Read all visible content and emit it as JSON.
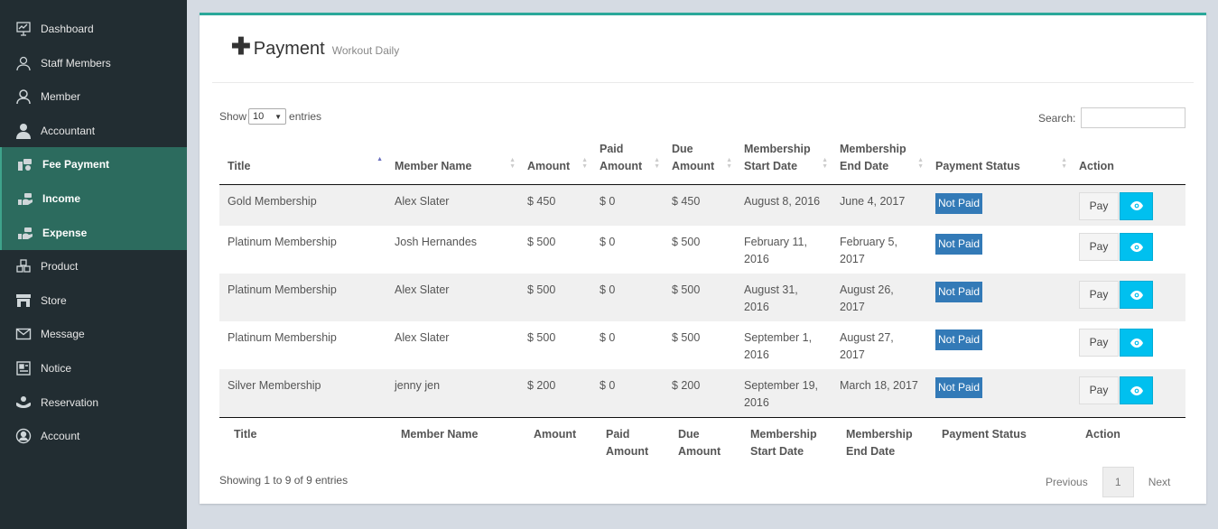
{
  "sidebar": {
    "items": [
      {
        "label": "Dashboard",
        "icon": "dashboard-icon",
        "active": false
      },
      {
        "label": "Staff Members",
        "icon": "staff-icon",
        "active": false
      },
      {
        "label": "Member",
        "icon": "member-icon",
        "active": false
      },
      {
        "label": "Accountant",
        "icon": "accountant-icon",
        "active": false
      },
      {
        "label": "Fee Payment",
        "icon": "fee-payment-icon",
        "active": true
      },
      {
        "label": "Income",
        "icon": "income-icon",
        "active": true
      },
      {
        "label": "Expense",
        "icon": "expense-icon",
        "active": true
      },
      {
        "label": "Product",
        "icon": "product-icon",
        "active": false
      },
      {
        "label": "Store",
        "icon": "store-icon",
        "active": false
      },
      {
        "label": "Message",
        "icon": "message-icon",
        "active": false
      },
      {
        "label": "Notice",
        "icon": "notice-icon",
        "active": false
      },
      {
        "label": "Reservation",
        "icon": "reservation-icon",
        "active": false
      },
      {
        "label": "Account",
        "icon": "account-icon",
        "active": false
      }
    ]
  },
  "page": {
    "title": "Payment",
    "subtitle": "Workout Daily"
  },
  "controls": {
    "show_label": "Show",
    "entries_value": "10",
    "entries_label": "entries",
    "search_label": "Search:",
    "search_value": ""
  },
  "table": {
    "headers": {
      "title": "Title",
      "member": "Member Name",
      "amount": "Amount",
      "paid": "Paid Amount",
      "due": "Due Amount",
      "start": "Membership Start Date",
      "end": "Membership End Date",
      "status": "Payment Status",
      "action": "Action"
    },
    "rows": [
      {
        "title": "Gold Membership",
        "member": "Alex Slater",
        "amount": "$ 450",
        "paid": "$ 0",
        "due": "$ 450",
        "start": "August 8, 2016",
        "end": "June 4, 2017",
        "status": "Not Paid",
        "pay": "Pay"
      },
      {
        "title": "Platinum Membership",
        "member": "Josh Hernandes",
        "amount": "$ 500",
        "paid": "$ 0",
        "due": "$ 500",
        "start": "February 11, 2016",
        "end": "February 5, 2017",
        "status": "Not Paid",
        "pay": "Pay"
      },
      {
        "title": "Platinum Membership",
        "member": "Alex Slater",
        "amount": "$ 500",
        "paid": "$ 0",
        "due": "$ 500",
        "start": "August 31, 2016",
        "end": "August 26, 2017",
        "status": "Not Paid",
        "pay": "Pay"
      },
      {
        "title": "Platinum Membership",
        "member": "Alex Slater",
        "amount": "$ 500",
        "paid": "$ 0",
        "due": "$ 500",
        "start": "September 1, 2016",
        "end": "August 27, 2017",
        "status": "Not Paid",
        "pay": "Pay"
      },
      {
        "title": "Silver Membership",
        "member": "jenny jen",
        "amount": "$ 200",
        "paid": "$ 0",
        "due": "$ 200",
        "start": "September 19, 2016",
        "end": "March 18, 2017",
        "status": "Not Paid",
        "pay": "Pay"
      }
    ]
  },
  "footer": {
    "info": "Showing 1 to 9 of 9 entries",
    "previous": "Previous",
    "page": "1",
    "next": "Next"
  },
  "colors": {
    "sidebar_bg": "#222d32",
    "sidebar_active": "#2c6b5e",
    "panel_accent": "#2aa89a",
    "badge": "#337ab7",
    "view_button": "#00c0ef"
  }
}
